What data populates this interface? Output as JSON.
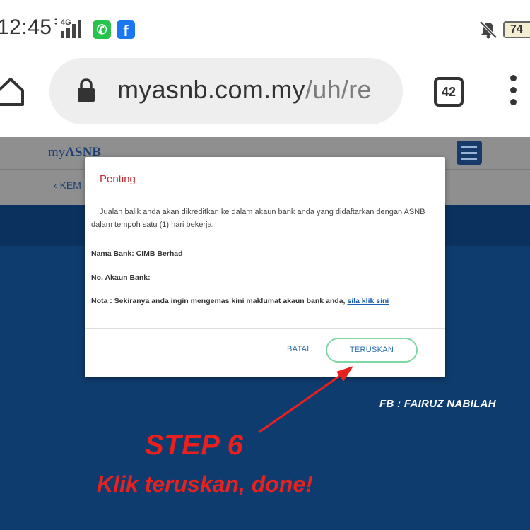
{
  "status_bar": {
    "time": "12:45",
    "network": "4G",
    "battery": "74"
  },
  "browser": {
    "url_main": "myasnb.com.my",
    "url_path": "/uh/re",
    "tab_count": "42"
  },
  "site": {
    "logo_prefix": "my",
    "logo_main": "ASNB",
    "back_label": "KEM"
  },
  "modal": {
    "title": "Penting",
    "message": "Jualan balik anda akan dikreditkan ke dalam akaun bank anda yang didaftarkan dengan ASNB dalam tempoh satu (1) hari bekerja.",
    "bank_name_label": "Nama Bank:",
    "bank_name_value": "CIMB Berhad",
    "account_label": "No. Akaun Bank:",
    "note_label": "Nota : Sekiranya anda ingin mengemas kini maklumat akaun bank anda,",
    "note_link": "sila klik sini",
    "cancel_label": "BATAL",
    "continue_label": "TERUSKAN"
  },
  "overlay": {
    "credit": "FB : FAIRUZ NABILAH",
    "step_title": "STEP 6",
    "step_subtitle": "Klik teruskan, done!",
    "accent_color": "#e8201e"
  }
}
